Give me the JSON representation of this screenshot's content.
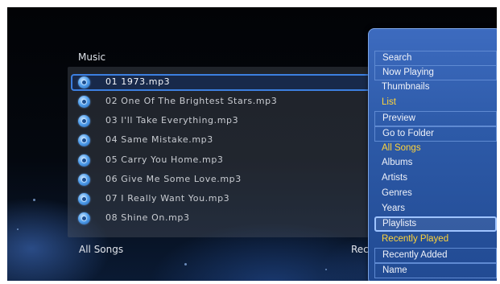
{
  "browser": {
    "title": "Music",
    "footer_left": "All Songs",
    "footer_right": "Rec"
  },
  "songs": [
    {
      "label": "01 1973.mp3",
      "icon": "music-disc-icon"
    },
    {
      "label": "02 One Of The Brightest Stars.mp3",
      "icon": "music-disc-icon"
    },
    {
      "label": "03 I'll Take Everything.mp3",
      "icon": "music-disc-icon"
    },
    {
      "label": "04 Same Mistake.mp3",
      "icon": "music-disc-icon"
    },
    {
      "label": "05 Carry You Home.mp3",
      "icon": "music-disc-icon"
    },
    {
      "label": "06 Give Me Some Love.mp3",
      "icon": "music-disc-icon"
    },
    {
      "label": "07 I Really Want You.mp3",
      "icon": "music-disc-icon"
    },
    {
      "label": "08 Shine On.mp3",
      "icon": "music-disc-icon"
    }
  ],
  "selected_song": "01 1973.mp3",
  "menu": {
    "items": [
      {
        "label": "Search",
        "style": "boxed"
      },
      {
        "label": "Now Playing",
        "style": "boxed"
      },
      {
        "label": "Thumbnails",
        "style": "plain"
      },
      {
        "label": "List",
        "style": "highlight"
      },
      {
        "label": "Preview",
        "style": "boxed"
      },
      {
        "label": "Go to Folder",
        "style": "boxed"
      },
      {
        "label": "All Songs",
        "style": "highlight"
      },
      {
        "label": "Albums",
        "style": "plain"
      },
      {
        "label": "Artists",
        "style": "plain"
      },
      {
        "label": "Genres",
        "style": "plain"
      },
      {
        "label": "Years",
        "style": "plain"
      },
      {
        "label": "Playlists",
        "style": "selected"
      },
      {
        "label": "Recently Played",
        "style": "highlight"
      },
      {
        "label": "Recently Added",
        "style": "boxed"
      },
      {
        "label": "Name",
        "style": "boxed"
      }
    ]
  },
  "colors": {
    "menu_background": "#2d5aa8",
    "highlight_text": "#ffd43a",
    "selection_border": "#3c7fe0",
    "screen_background": "#04080f"
  }
}
